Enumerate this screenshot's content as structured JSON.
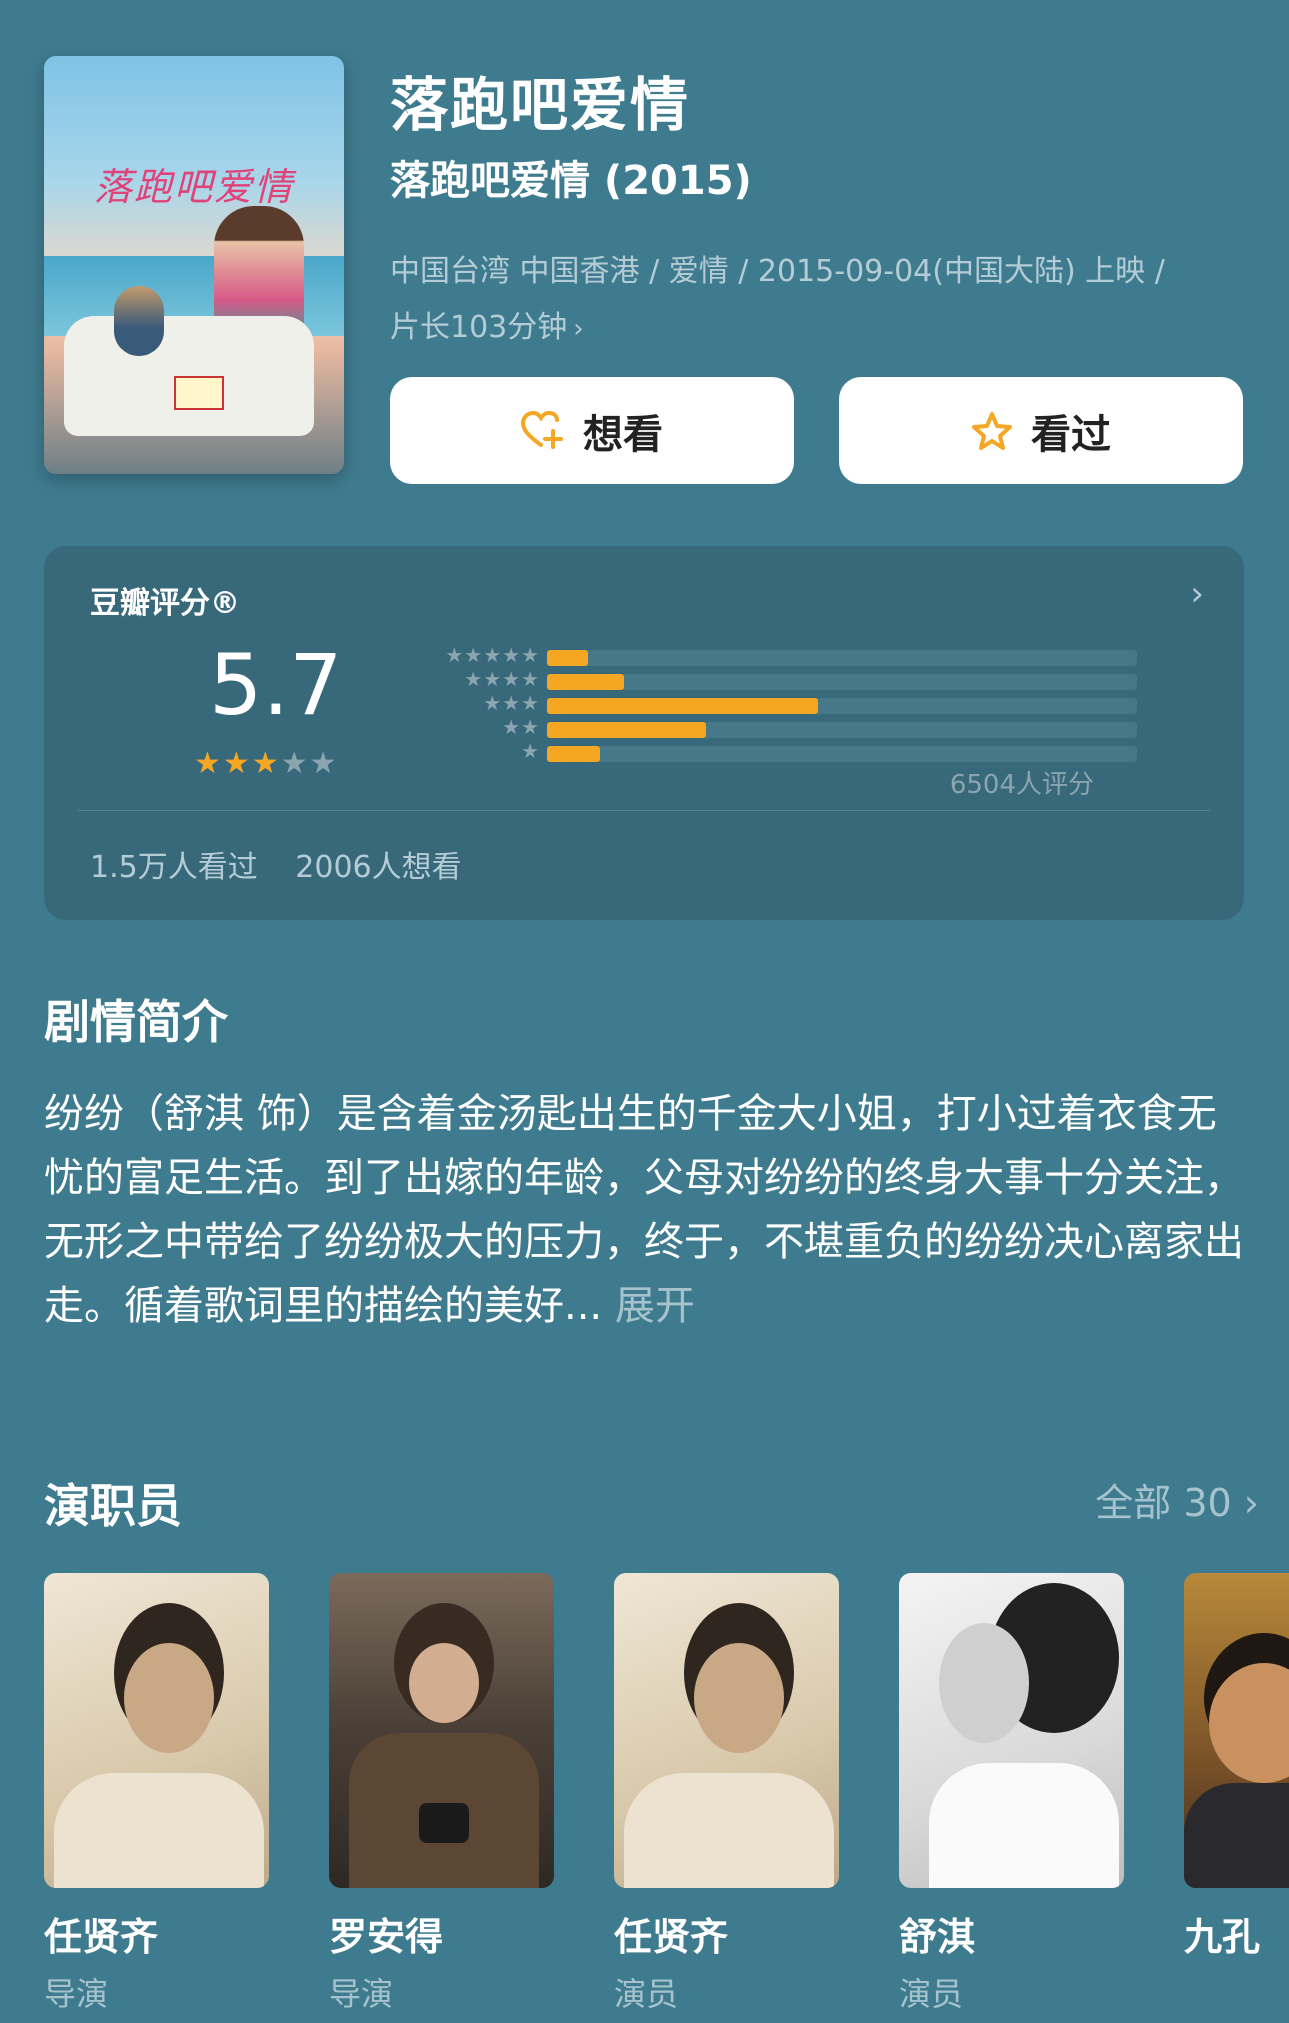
{
  "movie": {
    "title": "落跑吧爱情",
    "subtitle": "落跑吧爱情 (2015)",
    "meta_line1": "中国台湾 中国香港 / 爱情 / 2015-09-04(中国大陆) 上映 /",
    "meta_line2": "片长103分钟"
  },
  "actions": {
    "want_label": "想看",
    "seen_label": "看过"
  },
  "rating": {
    "label": "豆瓣评分®",
    "score": "5.7",
    "stars_filled": 3,
    "stars_total": 5,
    "distribution_percent": [
      7,
      13,
      46,
      27,
      9
    ],
    "vote_count": "6504人评分",
    "watched": "1.5万人看过",
    "wanted": "2006人想看",
    "accent_color": "#f5a623"
  },
  "synopsis": {
    "heading": "剧情简介",
    "text": "纷纷（舒淇 饰）是含着金汤匙出生的千金大小姐，打小过着衣食无忧的富足生活。到了出嫁的年龄，父母对纷纷的终身大事十分关注，无形之中带给了纷纷极大的压力，终于，不堪重负的纷纷决心离家出走。循着歌词里的描绘的美好...",
    "more_label": "展开"
  },
  "cast": {
    "heading": "演职员",
    "see_all": "全部 30",
    "members": [
      {
        "name": "任贤齐",
        "role": "导演"
      },
      {
        "name": "罗安得",
        "role": "导演"
      },
      {
        "name": "任贤齐",
        "role": "演员"
      },
      {
        "name": "舒淇",
        "role": "演员"
      },
      {
        "name": "九孔",
        "role": ""
      }
    ]
  },
  "icons": {
    "want": "heart-plus-icon",
    "seen": "star-outline-icon",
    "chevron": "chevron-right-icon"
  },
  "background_color": "#3f7b8f"
}
